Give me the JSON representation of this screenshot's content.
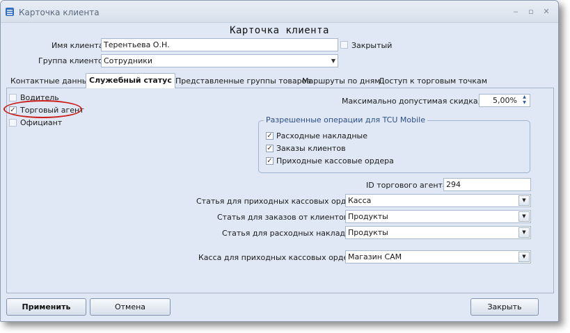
{
  "window": {
    "title": "Карточка клиента"
  },
  "form": {
    "heading": "Карточка клиента",
    "client_name_label": "Имя клиента",
    "client_name_value": "Терентьева О.Н.",
    "closed_label": "Закрытый",
    "closed_checked": false,
    "client_group_label": "Группа клиентов",
    "client_group_value": "Сотрудники"
  },
  "tabs": [
    {
      "label": "Контактные данные",
      "active": false
    },
    {
      "label": "Служебный статус",
      "active": true
    },
    {
      "label": "Представленные группы товаров",
      "active": false
    },
    {
      "label": "Маршруты по дням",
      "active": false
    },
    {
      "label": "Доступ к торговым точкам",
      "active": false
    }
  ],
  "status": {
    "roles": [
      {
        "label": "Водитель",
        "checked": false,
        "mark": ""
      },
      {
        "label": "Торговый агент",
        "checked": true,
        "mark": "✓"
      },
      {
        "label": "Официант",
        "checked": false,
        "mark": ""
      }
    ],
    "max_discount_label": "Максимально допустимая скидка, %",
    "max_discount_value": "5,00%",
    "ops_group_title": "Разрешенные операции для TCU Mobile",
    "ops": [
      {
        "label": "Расходные накладные",
        "checked": true,
        "mark": "✓"
      },
      {
        "label": "Заказы клиентов",
        "checked": true,
        "mark": "✓"
      },
      {
        "label": "Приходные кассовые ордера",
        "checked": true,
        "mark": "✓"
      }
    ],
    "agent_id_label": "ID торгового агента",
    "agent_id_value": "294",
    "income_orders_article_label": "Статья для приходных кассовых ордеров",
    "income_orders_article_value": "Касса",
    "client_orders_article_label": "Статья для заказов от клиентов",
    "client_orders_article_value": "Продукты",
    "expense_invoices_article_label": "Статья для расходных накладных",
    "expense_invoices_article_value": "Продукты",
    "cashbox_label": "Касса для приходных кассовых ордеров",
    "cashbox_value": "Магазин САМ"
  },
  "buttons": {
    "apply": "Применить",
    "cancel": "Отмена",
    "close": "Закрыть"
  },
  "colors": {
    "highlight": "#cc1f1f",
    "group_title": "#2d4f86",
    "background": "#dfe8f4"
  }
}
